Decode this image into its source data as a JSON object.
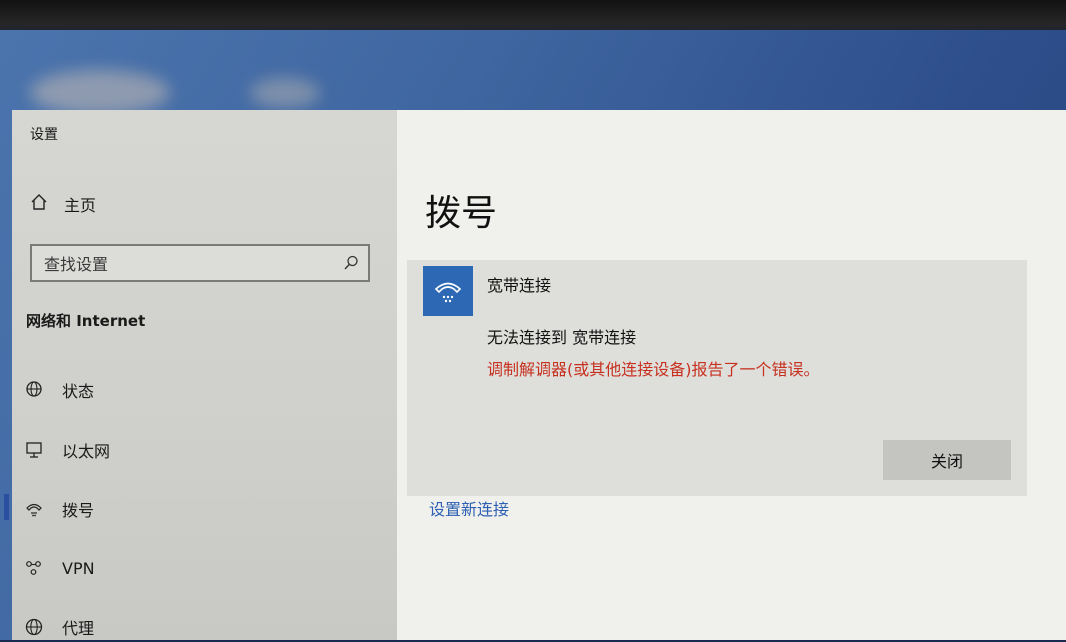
{
  "window": {
    "title": "设置"
  },
  "sidebar": {
    "home_label": "主页",
    "search_placeholder": "查找设置",
    "section_title": "网络和 Internet",
    "items": [
      {
        "label": "状态",
        "icon": "globe-status-icon"
      },
      {
        "label": "以太网",
        "icon": "ethernet-icon"
      },
      {
        "label": "拨号",
        "icon": "dialup-icon",
        "selected": true
      },
      {
        "label": "VPN",
        "icon": "vpn-icon"
      },
      {
        "label": "代理",
        "icon": "globe-icon"
      }
    ]
  },
  "main": {
    "title": "拨号",
    "connection": {
      "name": "宽带连接",
      "error_title": "无法连接到 宽带连接",
      "error_message": "调制解调器(或其他连接设备)报告了一个错误。",
      "close_label": "关闭"
    },
    "setup_link": "设置新连接"
  },
  "colors": {
    "accent": "#2d68b4",
    "error": "#c7301f",
    "link": "#2d5fb3"
  }
}
